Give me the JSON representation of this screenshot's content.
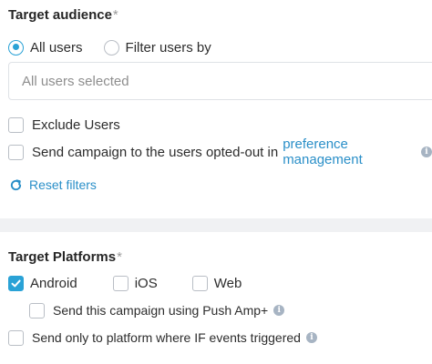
{
  "target_audience": {
    "title": "Target audience",
    "required_mark": "*",
    "radio_options": [
      {
        "label": "All users",
        "selected": true
      },
      {
        "label": "Filter users by",
        "selected": false
      }
    ],
    "filter_placeholder": "All users selected",
    "exclude_users": {
      "label": "Exclude Users",
      "checked": false
    },
    "opted_out": {
      "label": "Send campaign to the users opted-out in",
      "link_text": "preference management",
      "checked": false,
      "info_icon": "info-icon"
    },
    "reset_filters_label": "Reset filters",
    "reset_icon": "refresh-icon"
  },
  "target_platforms": {
    "title": "Target Platforms",
    "required_mark": "*",
    "platforms": [
      {
        "label": "Android",
        "checked": true
      },
      {
        "label": "iOS",
        "checked": false
      },
      {
        "label": "Web",
        "checked": false
      }
    ],
    "push_amp": {
      "label": "Send this campaign using Push Amp+",
      "checked": false,
      "info_icon": "info-icon"
    },
    "if_events": {
      "label": "Send only to platform where IF events triggered",
      "checked": false,
      "info_icon": "info-icon"
    }
  },
  "colors": {
    "accent": "#2aa2d6",
    "link": "#2a8fc8",
    "border": "#b9bec5",
    "divider_band": "#f0f1f3"
  }
}
